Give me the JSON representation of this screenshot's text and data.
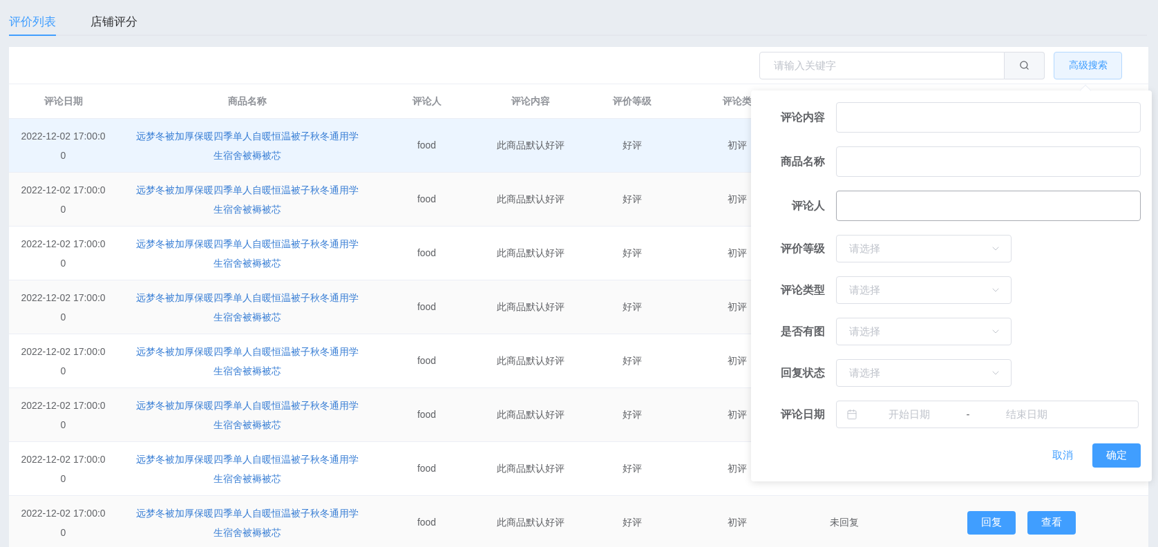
{
  "tabs": [
    {
      "label": "评价列表",
      "selected": true
    },
    {
      "label": "店铺评分",
      "selected": false
    }
  ],
  "search": {
    "placeholder": "请输入关键字"
  },
  "advanced_button": "高级搜索",
  "table": {
    "columns": [
      "评论日期",
      "商品名称",
      "评论人",
      "评论内容",
      "评价等级",
      "评论类"
    ],
    "rows": [
      {
        "highlighted": true,
        "date": "2022-12-02 17:00:00",
        "product": "远梦冬被加厚保暖四季单人自暖恒温被子秋冬通用学生宿舍被褥被芯",
        "reviewer": "food",
        "content": "此商品默认好评",
        "level": "好评",
        "type": "初评"
      },
      {
        "highlighted": false,
        "date": "2022-12-02 17:00:00",
        "product": "远梦冬被加厚保暖四季单人自暖恒温被子秋冬通用学生宿舍被褥被芯",
        "reviewer": "food",
        "content": "此商品默认好评",
        "level": "好评",
        "type": "初评"
      },
      {
        "highlighted": false,
        "date": "2022-12-02 17:00:00",
        "product": "远梦冬被加厚保暖四季单人自暖恒温被子秋冬通用学生宿舍被褥被芯",
        "reviewer": "food",
        "content": "此商品默认好评",
        "level": "好评",
        "type": "初评"
      },
      {
        "highlighted": false,
        "date": "2022-12-02 17:00:00",
        "product": "远梦冬被加厚保暖四季单人自暖恒温被子秋冬通用学生宿舍被褥被芯",
        "reviewer": "food",
        "content": "此商品默认好评",
        "level": "好评",
        "type": "初评"
      },
      {
        "highlighted": false,
        "date": "2022-12-02 17:00:00",
        "product": "远梦冬被加厚保暖四季单人自暖恒温被子秋冬通用学生宿舍被褥被芯",
        "reviewer": "food",
        "content": "此商品默认好评",
        "level": "好评",
        "type": "初评"
      },
      {
        "highlighted": false,
        "date": "2022-12-02 17:00:00",
        "product": "远梦冬被加厚保暖四季单人自暖恒温被子秋冬通用学生宿舍被褥被芯",
        "reviewer": "food",
        "content": "此商品默认好评",
        "level": "好评",
        "type": "初评"
      },
      {
        "highlighted": false,
        "date": "2022-12-02 17:00:00",
        "product": "远梦冬被加厚保暖四季单人自暖恒温被子秋冬通用学生宿舍被褥被芯",
        "reviewer": "food",
        "content": "此商品默认好评",
        "level": "好评",
        "type": "初评"
      },
      {
        "highlighted": false,
        "date": "2022-12-02 17:00:00",
        "product": "远梦冬被加厚保暖四季单人自暖恒温被子秋冬通用学生宿舍被褥被芯",
        "reviewer": "food",
        "content": "此商品默认好评",
        "level": "好评",
        "type": "初评",
        "reply_status": "未回复",
        "actions": [
          "回复",
          "查看"
        ]
      }
    ]
  },
  "advanced_search": {
    "fields": [
      {
        "kind": "text",
        "label": "评论内容",
        "focused": false
      },
      {
        "kind": "text",
        "label": "商品名称",
        "focused": false
      },
      {
        "kind": "text",
        "label": "评论人",
        "focused": true
      },
      {
        "kind": "select",
        "label": "评价等级",
        "placeholder": "请选择"
      },
      {
        "kind": "select",
        "label": "评论类型",
        "placeholder": "请选择"
      },
      {
        "kind": "select",
        "label": "是否有图",
        "placeholder": "请选择"
      },
      {
        "kind": "select",
        "label": "回复状态",
        "placeholder": "请选择"
      },
      {
        "kind": "daterange",
        "label": "评论日期",
        "start_placeholder": "开始日期",
        "separator": "-",
        "end_placeholder": "结束日期"
      }
    ],
    "cancel": "取消",
    "confirm": "确定"
  }
}
